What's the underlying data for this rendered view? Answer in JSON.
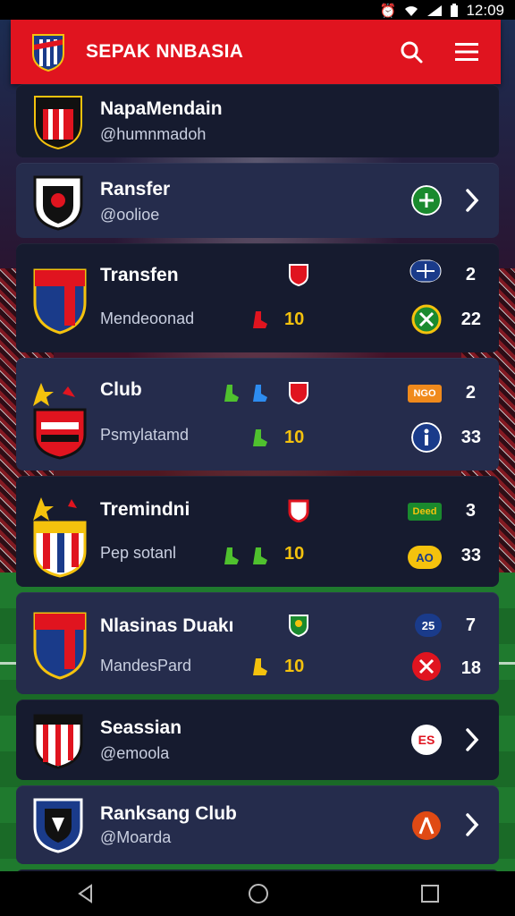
{
  "status_bar": {
    "time": "12:09"
  },
  "app_bar": {
    "title": "SEPAK NNBASIA"
  },
  "rows": [
    {
      "title": "NapaMendain",
      "subtitle": "@humnmadoh"
    },
    {
      "title": "Ransfer",
      "subtitle": "@oolioe"
    },
    {
      "title": "Transfen",
      "subtitle": "Mendeoonad",
      "score": "10",
      "num1": "2",
      "num2": "22",
      "badge": ""
    },
    {
      "title": "Club",
      "subtitle": "Psmylatamd",
      "score": "10",
      "num1": "2",
      "num2": "33",
      "badge": "NGO"
    },
    {
      "title": "Tremindni",
      "subtitle": "Pep  sotanl",
      "score": "10",
      "num1": "3",
      "num2": "33",
      "badge": "Deed",
      "badge2": "AO"
    },
    {
      "title": "Nlasinas Duakı",
      "subtitle": "MandesPard",
      "score": "10",
      "num1": "7",
      "num2": "18",
      "badge": "25"
    },
    {
      "title": "Seassian",
      "subtitle": "@emoola",
      "badge": "ES"
    },
    {
      "title": "Ranksang Club",
      "subtitle": "@Moarda"
    }
  ],
  "colors": {
    "primary": "#e0141f",
    "card": "#1c2340",
    "accent": "#f4c20d"
  }
}
